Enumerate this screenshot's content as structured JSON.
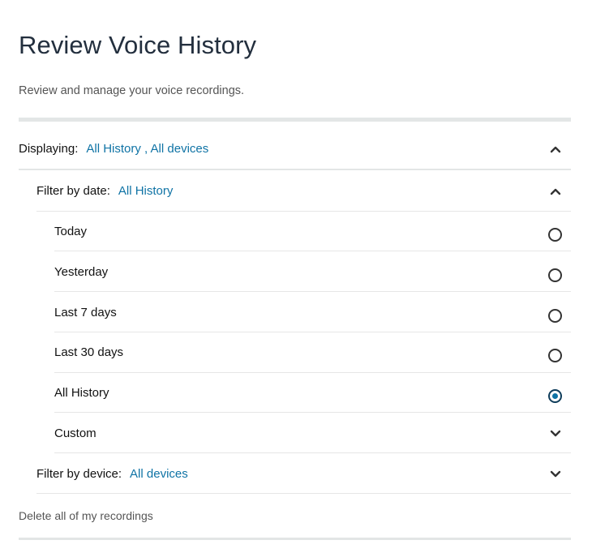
{
  "page": {
    "title": "Review Voice History",
    "subtitle": "Review and manage your voice recordings."
  },
  "displaying": {
    "label": "Displaying:",
    "value": "All History , All devices"
  },
  "date_filter": {
    "label": "Filter by date:",
    "value": "All History",
    "options": [
      {
        "label": "Today",
        "selected": false
      },
      {
        "label": "Yesterday",
        "selected": false
      },
      {
        "label": "Last 7 days",
        "selected": false
      },
      {
        "label": "Last 30 days",
        "selected": false
      },
      {
        "label": "All History",
        "selected": true
      },
      {
        "label": "Custom",
        "selected": false
      }
    ]
  },
  "device_filter": {
    "label": "Filter by device:",
    "value": "All devices"
  },
  "delete_link": "Delete all of my recordings",
  "colors": {
    "link": "#0f73a5",
    "title": "#232f3e",
    "divider": "#e3e6e6"
  },
  "icons": {
    "expanded": "chevron-up-icon",
    "collapsed": "chevron-down-icon",
    "radio_off": "radio-unselected-icon",
    "radio_on": "radio-selected-icon"
  }
}
